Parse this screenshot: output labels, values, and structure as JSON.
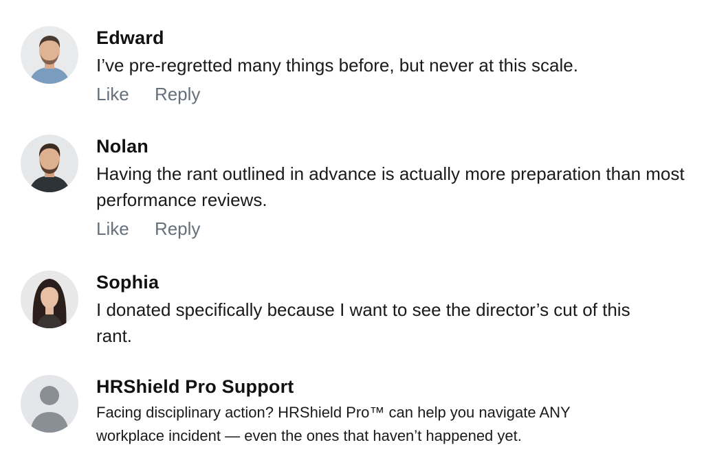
{
  "comments": [
    {
      "author": "Edward",
      "avatar": "man-short-hair-beard-avatar",
      "text": "I’ve pre-regretted many things before, but never at this scale.",
      "like_label": "Like",
      "reply_label": "Reply"
    },
    {
      "author": "Nolan",
      "avatar": "man-beard-avatar",
      "text": "Having the rant outlined in advance is actually more preparation than most performance reviews.",
      "like_label": "Like",
      "reply_label": "Reply"
    },
    {
      "author": "Sophia",
      "avatar": "woman-long-hair-avatar",
      "text": "I donated specifically because I want to see the director’s cut of this rant."
    },
    {
      "author": "HRShield Pro Support",
      "avatar": "default-user-avatar",
      "text": "Facing disciplinary action? HRShield Pro™ can help you navigate ANY workplace incident — even the ones that haven’t happened yet."
    }
  ],
  "colors": {
    "action_text": "#66707a",
    "body_text": "#1a1a1a",
    "placeholder_avatar_bg": "#e4e6ea",
    "placeholder_avatar_fg": "#8a8f96"
  }
}
